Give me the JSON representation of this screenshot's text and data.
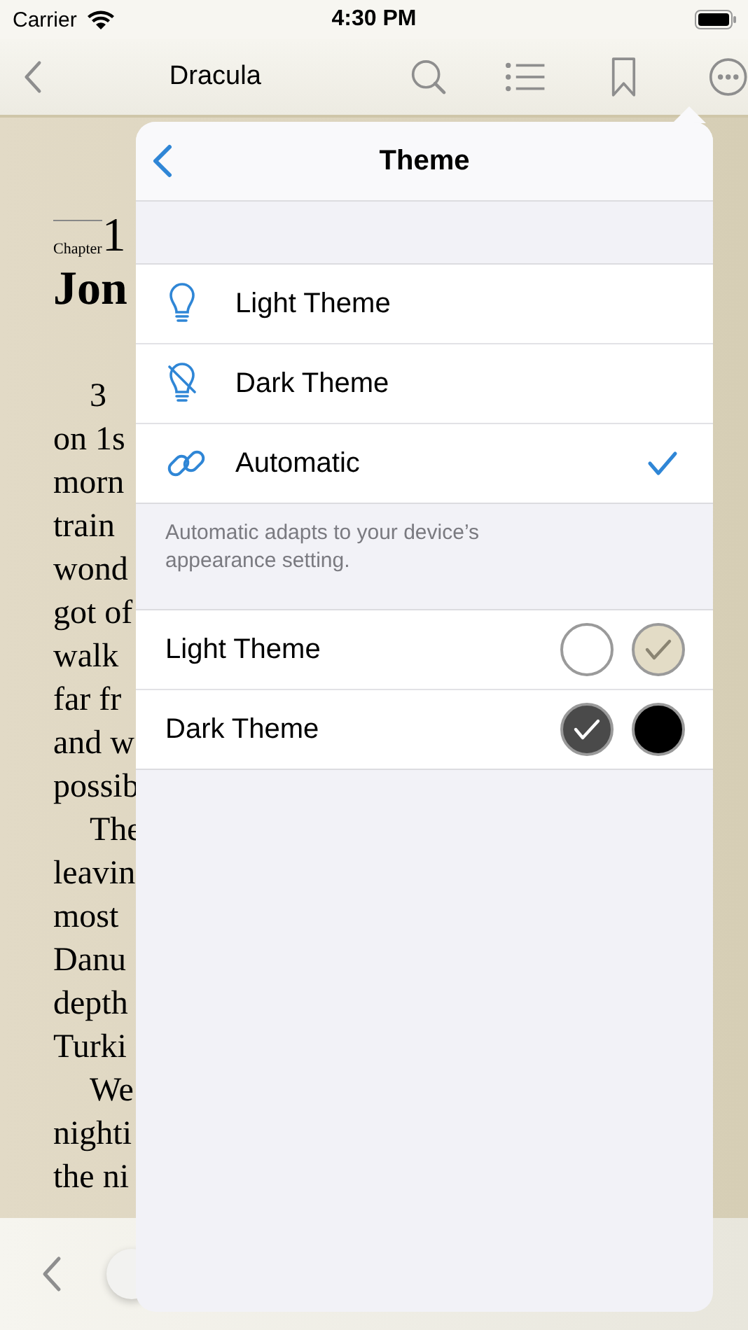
{
  "status_bar": {
    "carrier": "Carrier",
    "time": "4:30 PM"
  },
  "nav_bar": {
    "title": "Dracula"
  },
  "book_page": {
    "chapter_label": "Chapter",
    "chapter_number": "1",
    "heading": "Jon",
    "lines": [
      {
        "text": "3",
        "indent": true
      },
      {
        "text": "on 1s",
        "indent": false
      },
      {
        "text": "morn",
        "indent": false
      },
      {
        "text": "train",
        "indent": false
      },
      {
        "text": "wond",
        "indent": false
      },
      {
        "text": "got of",
        "indent": false
      },
      {
        "text": "walk",
        "indent": false
      },
      {
        "text": "far fr",
        "indent": false
      },
      {
        "text": "and w",
        "indent": false
      },
      {
        "text": "possib",
        "indent": false
      },
      {
        "text": "The",
        "indent": true
      },
      {
        "text": "leavin",
        "indent": false
      },
      {
        "text": "most",
        "indent": false
      },
      {
        "text": "Danu",
        "indent": false
      },
      {
        "text": "depth",
        "indent": false
      },
      {
        "text": "Turki",
        "indent": false
      },
      {
        "text": "We",
        "indent": true
      },
      {
        "text": "nighti",
        "indent": false
      },
      {
        "text": "the ni",
        "indent": false
      }
    ]
  },
  "theme_popover": {
    "title": "Theme",
    "options": [
      {
        "label": "Light Theme",
        "kind": "bulb",
        "selected": false
      },
      {
        "label": "Dark Theme",
        "kind": "bulb-off",
        "selected": false
      },
      {
        "label": "Automatic",
        "kind": "link",
        "selected": true
      }
    ],
    "footnote": "Automatic adapts to your device’s appearance setting.",
    "theme_colors": [
      {
        "label": "Light Theme",
        "swatches": [
          {
            "color": "#ffffff",
            "selected": false
          },
          {
            "color": "#e3dcc6",
            "selected": true
          }
        ]
      },
      {
        "label": "Dark Theme",
        "swatches": [
          {
            "color": "#4a4a4a",
            "selected": true
          },
          {
            "color": "#000000",
            "selected": false
          }
        ]
      }
    ]
  }
}
